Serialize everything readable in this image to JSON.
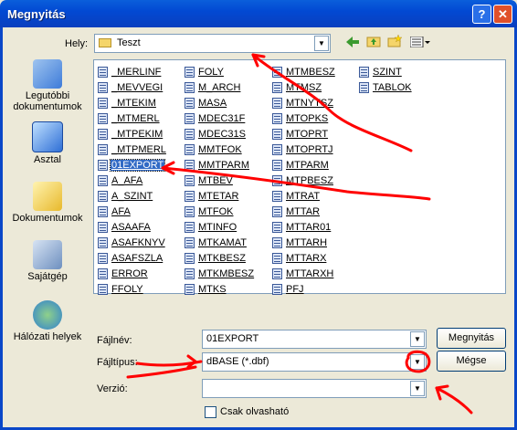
{
  "window": {
    "title": "Megnyitás",
    "help_label": "?",
    "close_label": "✕"
  },
  "location": {
    "label": "Hely:",
    "value": "Teszt"
  },
  "toolbar": {
    "back_glyph": "◆",
    "up_glyph": "⬆",
    "new_folder_glyph": "✱",
    "views_glyph": "▦"
  },
  "places": [
    {
      "label": "Legutóbbi dokumentumok",
      "icon": "recent-documents-icon"
    },
    {
      "label": "Asztal",
      "icon": "desktop-icon"
    },
    {
      "label": "Dokumentumok",
      "icon": "my-documents-icon"
    },
    {
      "label": "Sajátgép",
      "icon": "my-computer-icon"
    },
    {
      "label": "Hálózati helyek",
      "icon": "network-places-icon"
    }
  ],
  "files": {
    "col1": [
      "_MERLINF",
      "_MEVVEGI",
      "_MTEKIM",
      "_MTMERL",
      "_MTPEKIM",
      "_MTPMERL",
      "01EXPORT",
      "A_AFA",
      "A_SZINT",
      "AFA",
      "ASAAFA",
      "ASAFKNYV",
      "ASAFSZLA",
      "ERROR",
      "FFOLY"
    ],
    "col2": [
      "FOLY",
      "M_ARCH",
      "MASA",
      "MDEC31F",
      "MDEC31S",
      "MMTFOK",
      "MMTPARM",
      "MTBEV",
      "MTETAR",
      "MTFOK",
      "MTINFO",
      "MTKAMAT",
      "MTKBESZ",
      "MTKMBESZ",
      "MTKS"
    ],
    "col3": [
      "MTMBESZ",
      "MTMSZ",
      "MTNYTSZ",
      "MTOPKS",
      "MTOPRT",
      "MTOPRTJ",
      "MTPARM",
      "MTPBESZ",
      "MTRAT",
      "MTTAR",
      "MTTAR01",
      "MTTARH",
      "MTTARX",
      "MTTARXH",
      "PFJ"
    ],
    "col4": [
      "SZINT",
      "TABLOK"
    ],
    "selected": "01EXPORT"
  },
  "filename": {
    "label": "Fájlnév:",
    "value": "01EXPORT"
  },
  "filetype": {
    "label": "Fájltípus:",
    "value": "dBASE (*.dbf)"
  },
  "version": {
    "label": "Verzió:",
    "value": ""
  },
  "readonly": {
    "label": "Csak olvasható",
    "checked": false
  },
  "buttons": {
    "open": "Megnyitás",
    "cancel": "Mégse"
  },
  "colors": {
    "title_bar": "#0a5fdb",
    "dialog_bg": "#ece9d8",
    "selection": "#316ac5",
    "annotation": "#ff0000"
  }
}
